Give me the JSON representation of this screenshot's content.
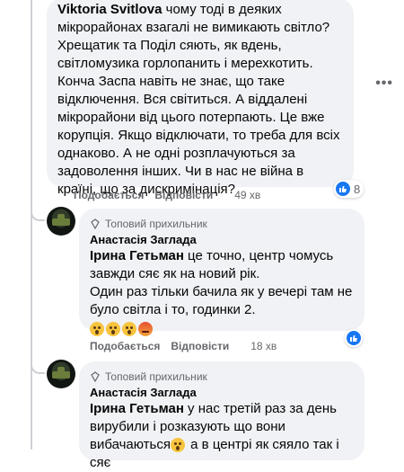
{
  "comment1": {
    "author": "Viktoria Svitlova",
    "text": "чому тоді в деяких мікрорайонах взагалі не вимикають світло? Хрещатик та Поділ сяють, як вдень, світломузика горлопанить і мерехкотить. Конча Заспа навіть не знає, що таке відключення. Вся світиться. А віддалені мікрорайони від цього потерпають. Це вже корупція. Якщо відключати, то треба для всіх однаково. А не одні розплачуються за задоволення інших. Чи в нас не війна в країні, що за дискримінація?",
    "like_label": "Подобається",
    "reply_label": "Відповісти",
    "time": "49 хв",
    "reaction_count": "8"
  },
  "reply1": {
    "badge": "Топовий прихильник",
    "author": "Анастасія Заглада",
    "mention": "Ірина Гетьман",
    "text": " це точно, центр чомусь завжди сяє як на новий рік.\nОдин раз тільки бачила як у вечері там не було світла і то, годинки 2.",
    "like_label": "Подобається",
    "reply_label": "Відповісти",
    "time": "18 хв"
  },
  "reply2": {
    "badge": "Топовий прихильник",
    "author": "Анастасія Заглада",
    "mention": "Ірина Гетьман",
    "text_before_emoji": " у нас третій раз за день вирубили і розказують що вони вибачаються",
    "text_after_emoji": " а в центрі як сяяло так і сяє"
  },
  "icons": {
    "more": "more-options-icon",
    "like_reaction": "like-reaction-icon",
    "badge": "top-fan-badge-icon",
    "shocked_emoji": "shocked-face-emoji",
    "angry_emoji": "angry-face-emoji"
  },
  "colors": {
    "bubble": "#f0f2f5",
    "secondary_text": "#65676b",
    "like_blue": "#1877f2",
    "thread_line": "#ced0d4"
  }
}
